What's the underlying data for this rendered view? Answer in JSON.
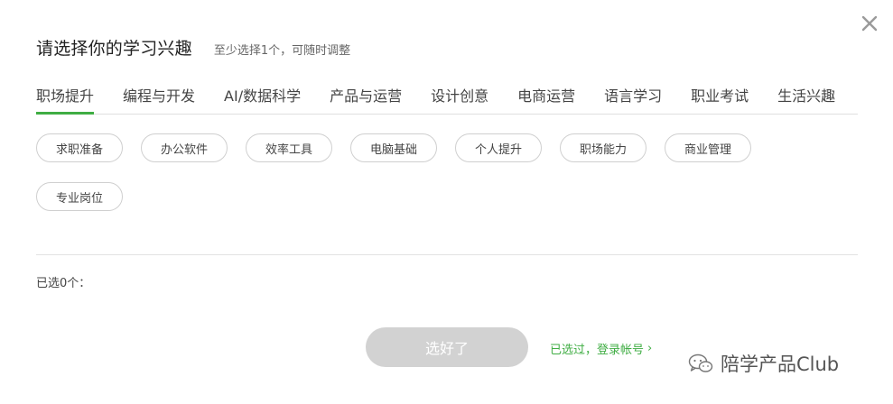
{
  "header": {
    "title": "请选择你的学习兴趣",
    "subtitle": "至少选择1个，可随时调整"
  },
  "tabs": [
    {
      "label": "职场提升",
      "active": true
    },
    {
      "label": "编程与开发",
      "active": false
    },
    {
      "label": "AI/数据科学",
      "active": false
    },
    {
      "label": "产品与运营",
      "active": false
    },
    {
      "label": "设计创意",
      "active": false
    },
    {
      "label": "电商运营",
      "active": false
    },
    {
      "label": "语言学习",
      "active": false
    },
    {
      "label": "职业考试",
      "active": false
    },
    {
      "label": "生活兴趣",
      "active": false
    }
  ],
  "chips": [
    "求职准备",
    "办公软件",
    "效率工具",
    "电脑基础",
    "个人提升",
    "职场能力",
    "商业管理",
    "专业岗位"
  ],
  "selection": {
    "label": "已选0个："
  },
  "actions": {
    "confirm_label": "选好了",
    "login_label": "已选过，登录帐号",
    "login_chevron": "›"
  },
  "watermark": {
    "text": "陪学产品Club"
  },
  "colors": {
    "accent": "#3fad43",
    "button_disabled": "#d2d2d2",
    "chip_border": "#cfcfcf"
  },
  "icons": {
    "close": "close-icon",
    "chevron": "chevron-right-icon",
    "watermark": "wechat-icon"
  }
}
